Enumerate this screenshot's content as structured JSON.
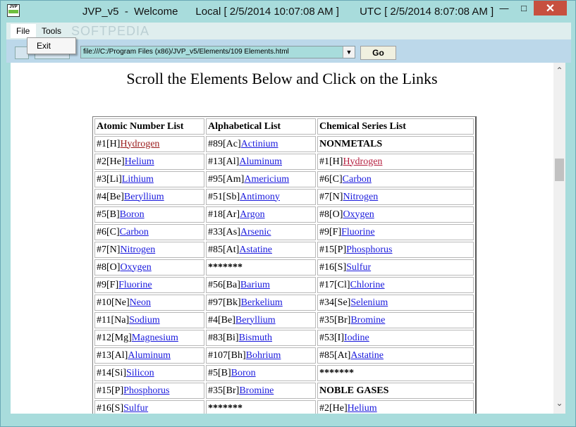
{
  "window": {
    "title": "JVP_v5  -  Welcome      Local [ 2/5/2014 10:07:08 AM ]       UTC [ 2/5/2014 8:07:08 AM ]",
    "app_icon_text": "JVP",
    "min_icon": "minimize-icon",
    "max_icon": "maximize-icon",
    "close_icon": "close-icon"
  },
  "menu": {
    "file": "File",
    "tools": "Tools",
    "dropdown_exit": "Exit"
  },
  "watermark": "SOFTPEDIA",
  "address": {
    "url": "file:///C:/Program Files (x86)/JVP_v5/Elements/109 Elements.html",
    "go": "Go"
  },
  "page": {
    "heading": "Scroll the Elements Below and Click on the Links"
  },
  "table": {
    "headers": [
      "Atomic Number List",
      "Alphabetical List",
      "Chemical Series List"
    ],
    "rows": [
      [
        {
          "p": "#1[H]",
          "l": "Hydrogen",
          "s": "visited"
        },
        {
          "p": "#89[Ac]",
          "l": "Actinium"
        },
        {
          "b": "NONMETALS"
        }
      ],
      [
        {
          "p": "#2[He]",
          "l": "Helium"
        },
        {
          "p": "#13[Al]",
          "l": "Aluminum"
        },
        {
          "p": "#1[H]",
          "l": "Hydrogen",
          "s": "hover"
        }
      ],
      [
        {
          "p": "#3[Li]",
          "l": "Lithium"
        },
        {
          "p": "#95[Am]",
          "l": "Americium"
        },
        {
          "p": "#6[C]",
          "l": "Carbon"
        }
      ],
      [
        {
          "p": "#4[Be]",
          "l": "Beryllium"
        },
        {
          "p": "#51[Sb]",
          "l": "Antimony"
        },
        {
          "p": "#7[N]",
          "l": "Nitrogen"
        }
      ],
      [
        {
          "p": "#5[B]",
          "l": "Boron"
        },
        {
          "p": "#18[Ar]",
          "l": "Argon"
        },
        {
          "p": "#8[O]",
          "l": "Oxygen"
        }
      ],
      [
        {
          "p": "#6[C]",
          "l": "Carbon"
        },
        {
          "p": "#33[As]",
          "l": "Arsenic"
        },
        {
          "p": "#9[F]",
          "l": "Fluorine"
        }
      ],
      [
        {
          "p": "#7[N]",
          "l": "Nitrogen"
        },
        {
          "p": "#85[At]",
          "l": "Astatine"
        },
        {
          "p": "#15[P]",
          "l": "Phosphorus"
        }
      ],
      [
        {
          "p": "#8[O]",
          "l": "Oxygen"
        },
        {
          "t": "*******"
        },
        {
          "p": "#16[S]",
          "l": "Sulfur"
        }
      ],
      [
        {
          "p": "#9[F]",
          "l": "Fluorine"
        },
        {
          "p": "#56[Ba]",
          "l": "Barium"
        },
        {
          "p": "#17[Cl]",
          "l": "Chlorine"
        }
      ],
      [
        {
          "p": "#10[Ne]",
          "l": "Neon"
        },
        {
          "p": "#97[Bk]",
          "l": "Berkelium"
        },
        {
          "p": "#34[Se]",
          "l": "Selenium"
        }
      ],
      [
        {
          "p": "#11[Na]",
          "l": "Sodium"
        },
        {
          "p": "#4[Be]",
          "l": "Beryllium"
        },
        {
          "p": "#35[Br]",
          "l": "Bromine"
        }
      ],
      [
        {
          "p": "#12[Mg]",
          "l": "Magnesium"
        },
        {
          "p": "#83[Bi]",
          "l": "Bismuth"
        },
        {
          "p": "#53[I]",
          "l": "Iodine"
        }
      ],
      [
        {
          "p": "#13[Al]",
          "l": "Aluminum"
        },
        {
          "p": "#107[Bh]",
          "l": "Bohrium"
        },
        {
          "p": "#85[At]",
          "l": "Astatine"
        }
      ],
      [
        {
          "p": "#14[Si]",
          "l": "Silicon"
        },
        {
          "p": "#5[B]",
          "l": "Boron"
        },
        {
          "t": "*******"
        }
      ],
      [
        {
          "p": "#15[P]",
          "l": "Phosphorus"
        },
        {
          "p": "#35[Br]",
          "l": "Bromine"
        },
        {
          "b": "NOBLE GASES"
        }
      ],
      [
        {
          "p": "#16[S]",
          "l": "Sulfur"
        },
        {
          "t": "*******"
        },
        {
          "p": "#2[He]",
          "l": "Helium"
        }
      ]
    ]
  },
  "colors": {
    "link": "#1a1add",
    "visited_link": "#9a1a1a",
    "window_bg": "#a8dcdc",
    "close_button": "#c7503f"
  },
  "scrollbar": {
    "up_icon": "scroll-up-icon",
    "down_icon": "scroll-down-icon"
  }
}
